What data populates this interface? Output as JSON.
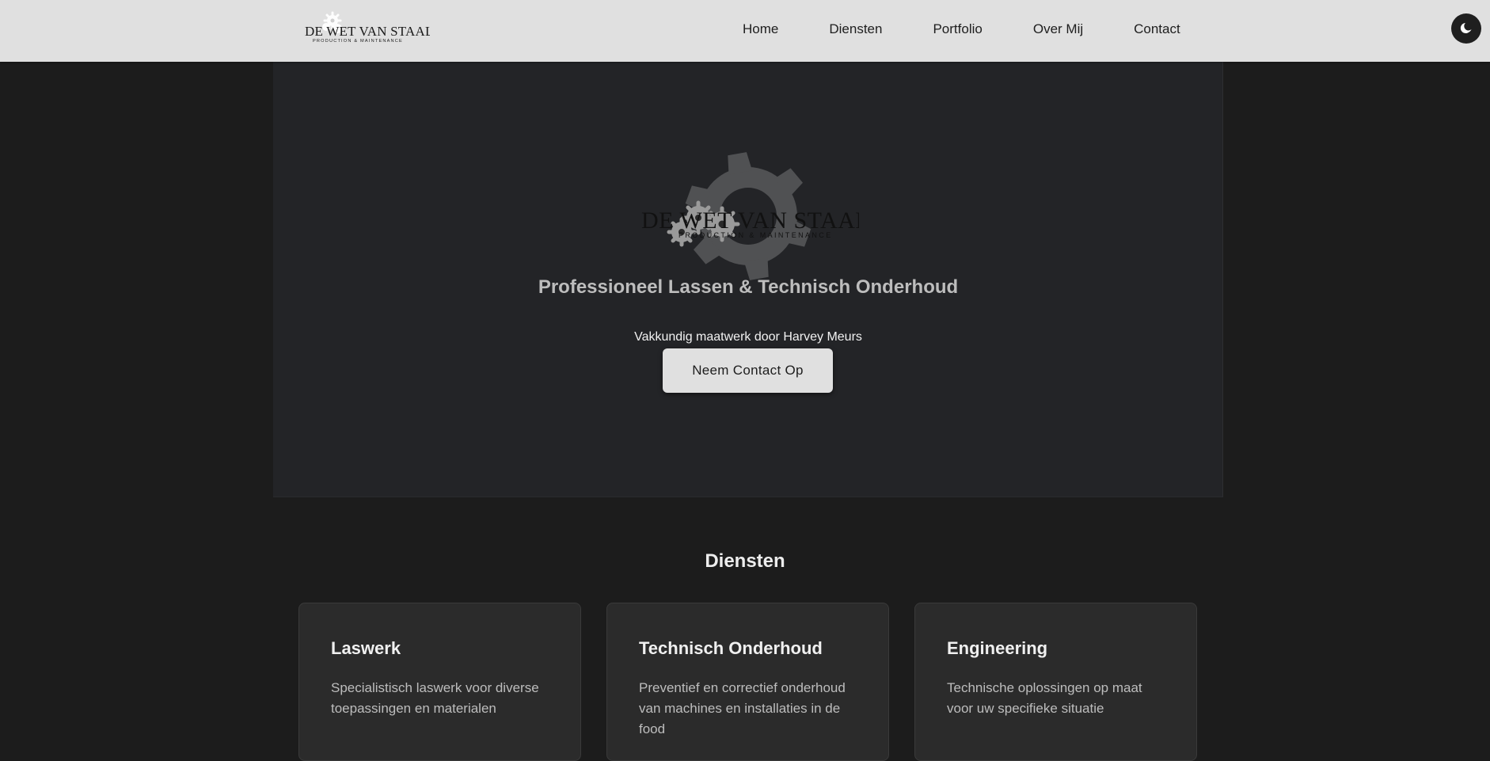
{
  "header": {
    "logo": {
      "name": "DE WET VAN STAAL",
      "tagline": "PRODUCTION & MAINTENANCE"
    },
    "nav": [
      {
        "label": "Home"
      },
      {
        "label": "Diensten"
      },
      {
        "label": "Portfolio"
      },
      {
        "label": "Over Mij"
      },
      {
        "label": "Contact"
      }
    ],
    "theme_toggle_icon": "moon-icon"
  },
  "hero": {
    "title": "Professioneel Lassen & Technisch Onderhoud",
    "subtitle": "Vakkundig maatwerk door Harvey Meurs",
    "cta_label": "Neem Contact Op"
  },
  "services": {
    "title": "Diensten",
    "items": [
      {
        "title": "Laswerk",
        "description": "Specialistisch laswerk voor diverse toepassingen en materialen"
      },
      {
        "title": "Technisch Onderhoud",
        "description": "Preventief en correctief onderhoud van machines en installaties in de food"
      },
      {
        "title": "Engineering",
        "description": "Technische oplossingen op maat voor uw specifieke situatie"
      }
    ]
  },
  "colors": {
    "header_bg": "#e0e0e0",
    "page_bg": "#1c1c1c",
    "hero_bg": "#232427",
    "card_bg": "#2b2b2b",
    "button_bg": "#e0e0e0"
  }
}
